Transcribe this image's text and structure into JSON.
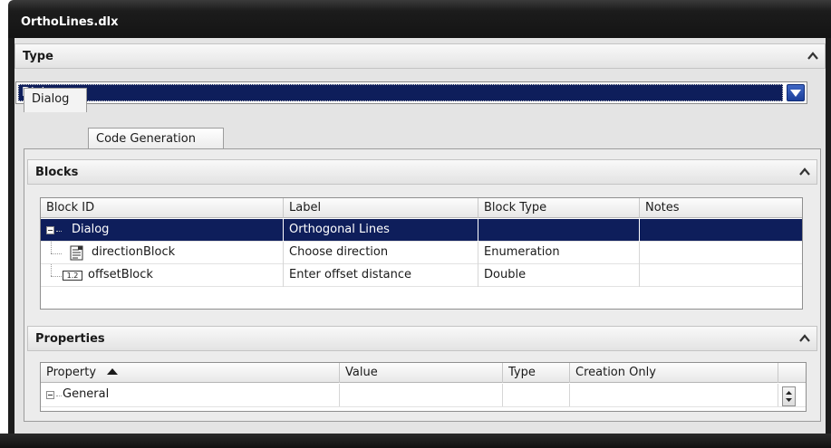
{
  "window": {
    "title": "OrthoLines.dlx"
  },
  "type_section": {
    "header": "Type",
    "selected_value": "Dialog"
  },
  "tabs": [
    {
      "label": "Dialog",
      "active": true
    },
    {
      "label": "Code Generation",
      "active": false
    }
  ],
  "blocks": {
    "header": "Blocks",
    "columns": [
      "Block ID",
      "Label",
      "Block Type",
      "Notes"
    ],
    "rows": [
      {
        "id": "Dialog",
        "label": "Orthogonal Lines",
        "block_type": "",
        "notes": "",
        "selected": true,
        "icon": "minus-toggle-icon"
      },
      {
        "id": "directionBlock",
        "label": "Choose direction",
        "block_type": "Enumeration",
        "notes": "",
        "selected": false,
        "icon": "enumeration-icon"
      },
      {
        "id": "offsetBlock",
        "label": "Enter offset distance",
        "block_type": "Double",
        "notes": "",
        "selected": false,
        "icon": "double-field-icon",
        "icon_text": "1.2"
      }
    ]
  },
  "properties": {
    "header": "Properties",
    "columns": [
      "Property",
      "Value",
      "Type",
      "Creation Only"
    ],
    "rows": [
      {
        "property": "General",
        "value": "",
        "type": "",
        "creation_only": ""
      }
    ]
  },
  "colors": {
    "selection": "#0e1e5b",
    "titlebar": "#1c1c1c",
    "panel_bg": "#e4e4e4"
  }
}
